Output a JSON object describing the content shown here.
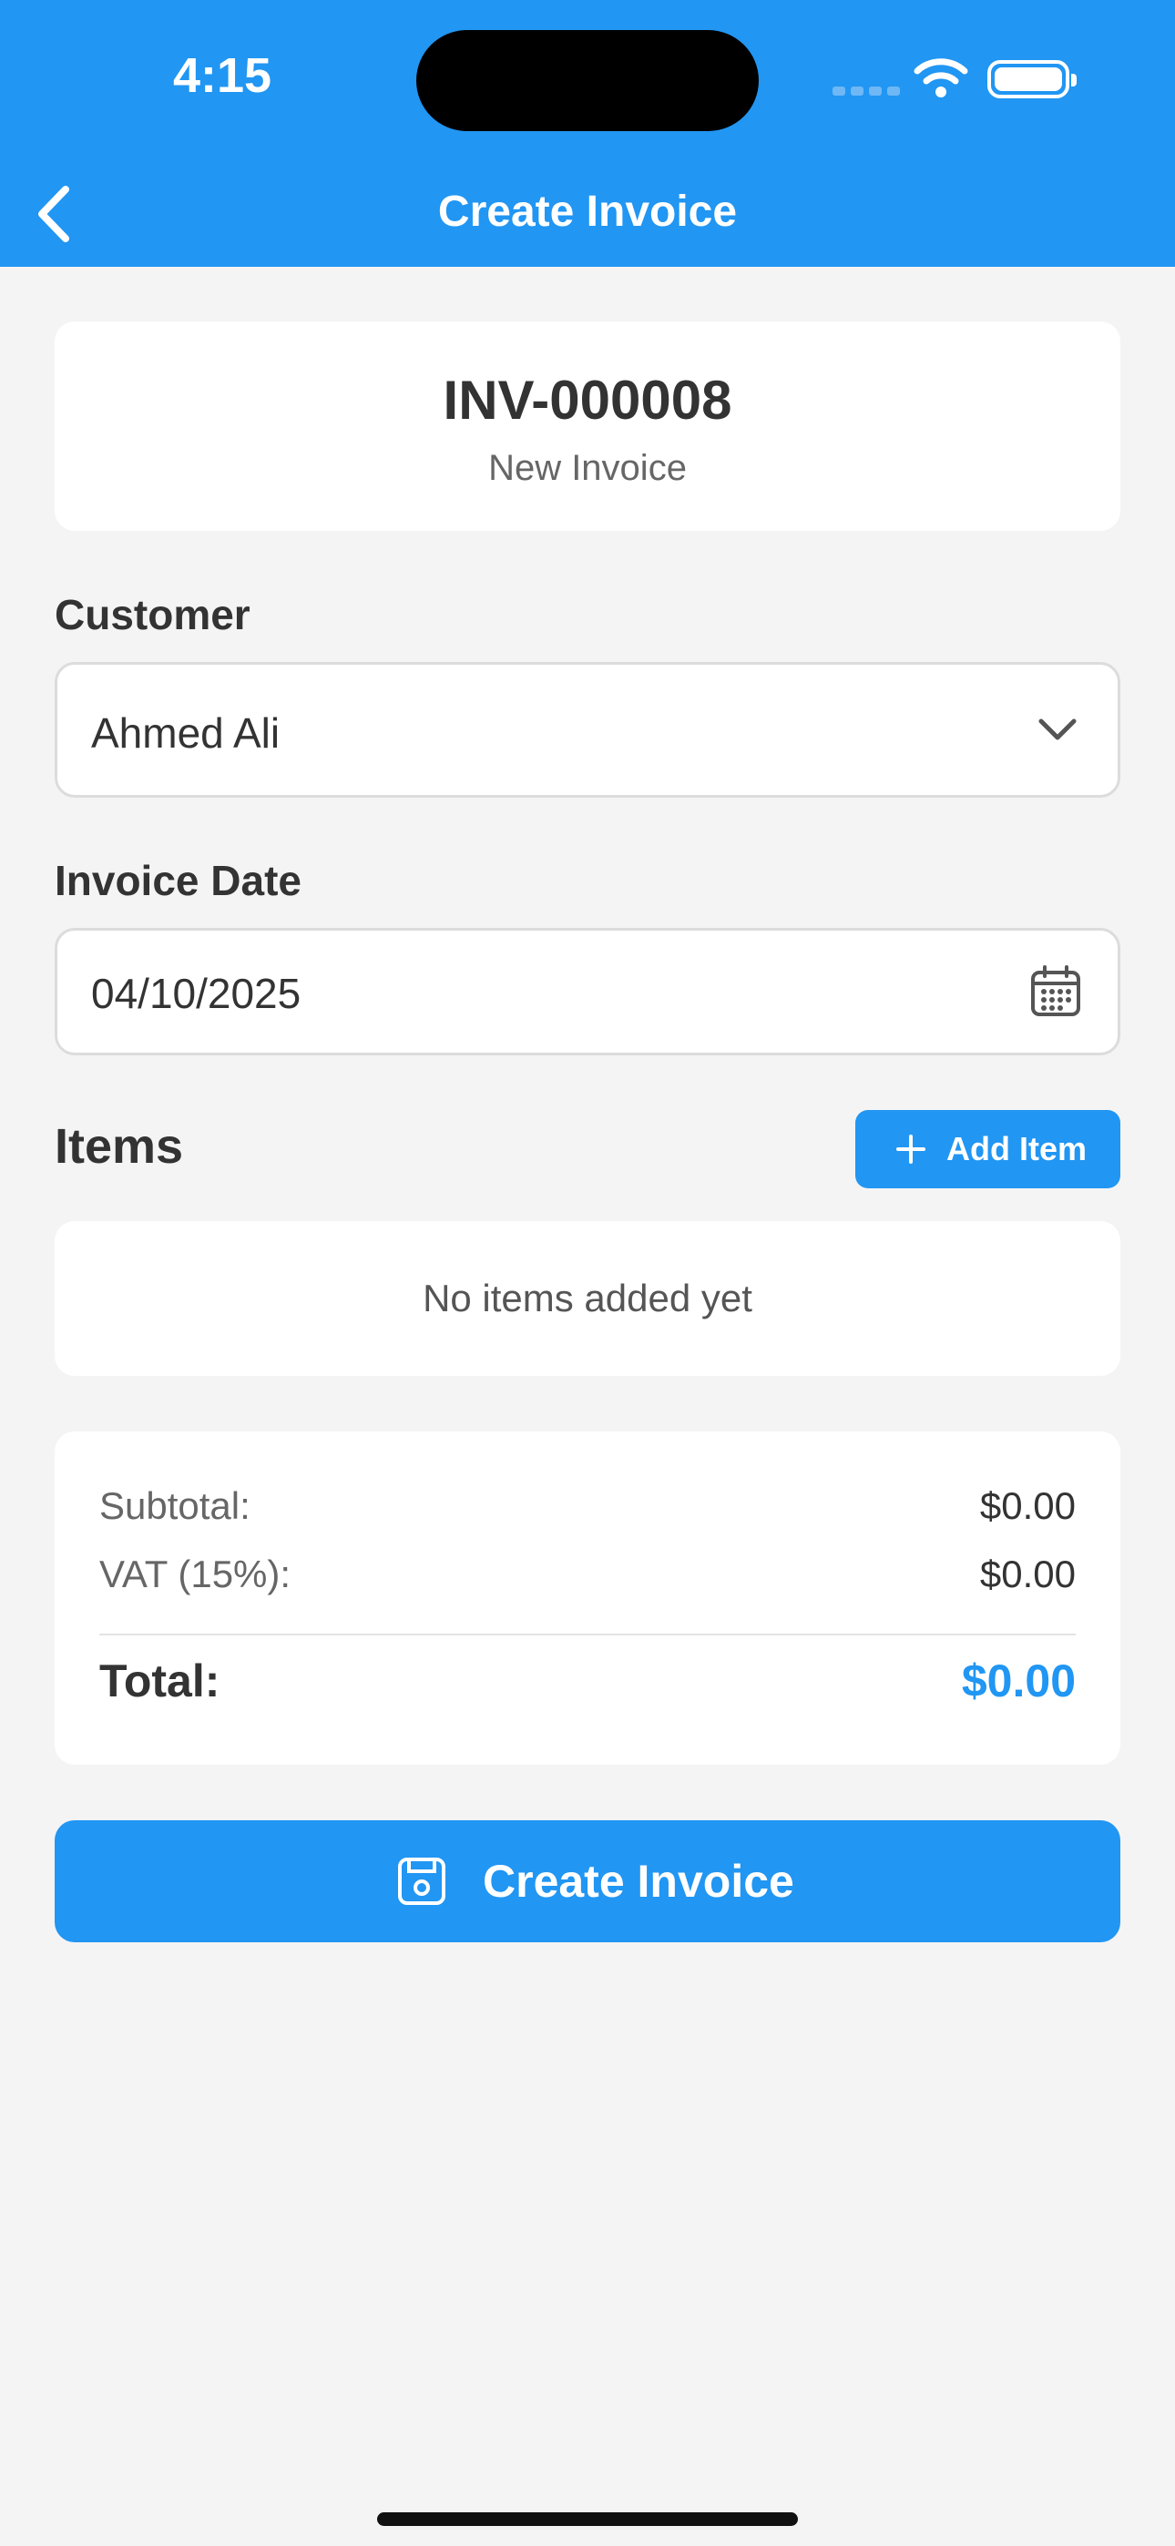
{
  "status": {
    "time": "4:15"
  },
  "nav": {
    "title": "Create Invoice",
    "back_icon": "chevron-left-icon"
  },
  "invoice": {
    "number": "INV-000008",
    "subtitle": "New Invoice"
  },
  "customer": {
    "label": "Customer",
    "value": "Ahmed Ali"
  },
  "date": {
    "label": "Invoice Date",
    "value": "04/10/2025"
  },
  "items": {
    "title": "Items",
    "add_label": "Add Item",
    "empty": "No items added yet"
  },
  "totals": {
    "subtotal_label": "Subtotal:",
    "subtotal": "$0.00",
    "vat_label": "VAT (15%):",
    "vat": "$0.00",
    "total_label": "Total:",
    "total": "$0.00"
  },
  "actions": {
    "create_label": "Create Invoice"
  },
  "colors": {
    "primary": "#2196f3",
    "background": "#f4f4f5"
  }
}
